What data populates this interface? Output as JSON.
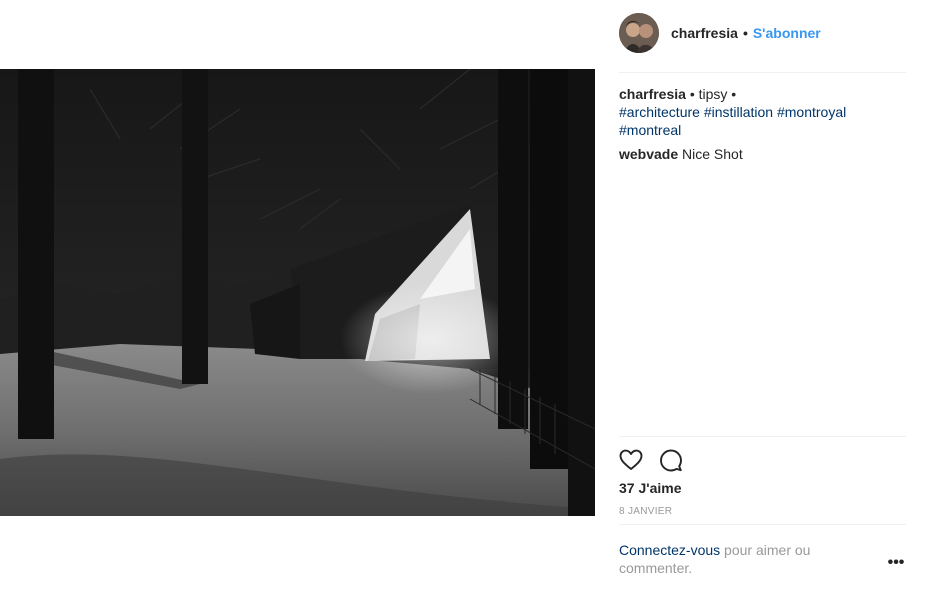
{
  "post": {
    "image_alt": "",
    "author": "charfresia",
    "separator": "•",
    "follow_label": "S'abonner"
  },
  "caption": {
    "user": "charfresia",
    "text": " • tipsy • ",
    "hashtags": [
      "#architecture",
      "#instillation",
      "#montroyal",
      "#montreal"
    ]
  },
  "comments": [
    {
      "user": "webvade",
      "text": "Nice Shot"
    }
  ],
  "actions": {
    "like_icon": "heart-icon",
    "comment_icon": "comment-bubble-icon"
  },
  "likes_label": "37 J'aime",
  "date_label": "8 JANVIER",
  "login_prompt": {
    "link": "Connectez-vous",
    "text": " pour aimer ou commenter."
  },
  "more_label": "•••",
  "colors": {
    "link": "#3897f0",
    "hashtag": "#003569",
    "muted": "#999999",
    "text": "#262626",
    "divider": "#efefef"
  }
}
